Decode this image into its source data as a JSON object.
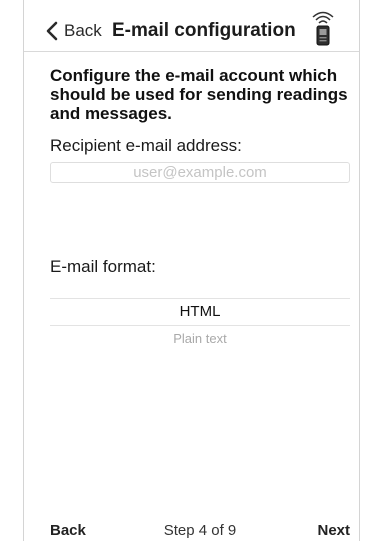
{
  "nav": {
    "back_label": "Back",
    "title": "E-mail configuration",
    "device_icon": "reader-device-icon"
  },
  "intro_text": "Configure the e-mail account which should be used for sending readings and messages.",
  "recipient": {
    "label": "Recipient e-mail address:",
    "value": "",
    "placeholder": "user@example.com"
  },
  "format": {
    "label": "E-mail format:",
    "options": [
      "HTML",
      "Plain text"
    ],
    "selected": "HTML"
  },
  "footer": {
    "back_label": "Back",
    "step_text": "Step 4 of 9",
    "next_label": "Next"
  },
  "colors": {
    "text": "#111111",
    "muted": "#a9a9a9",
    "divider": "#d9d9d9"
  }
}
